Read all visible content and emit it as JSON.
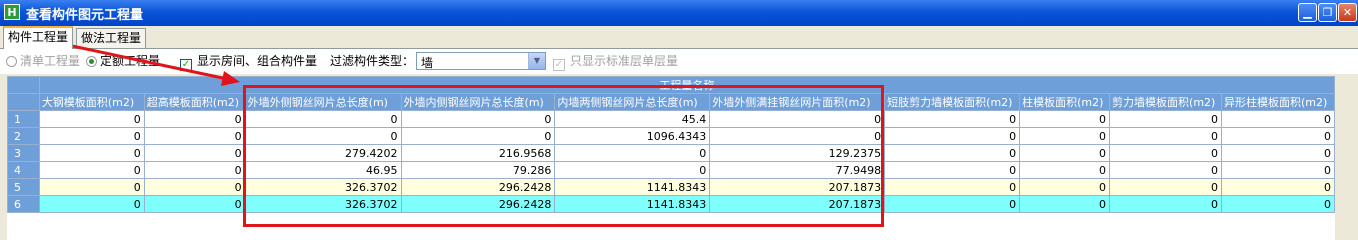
{
  "window": {
    "title": "查看构件图元工程量",
    "icon": "H",
    "minimize_icon": "minimize-icon",
    "restore_icon": "restore-icon",
    "close_icon": "close-icon"
  },
  "tabs": [
    {
      "label": "构件工程量",
      "active": true
    },
    {
      "label": "做法工程量",
      "active": false
    }
  ],
  "toolbar": {
    "radio_list_label": "清单工程量",
    "radio_quota_label": "定额工程量",
    "show_room_label": "显示房间、组合构件量",
    "filter_label": "过滤构件类型：",
    "filter_value": "墙",
    "standard_floor_label": "只显示标准层单层量"
  },
  "grid": {
    "group_header": "工程量名称",
    "columns": [
      "大钢模板面积(m2)",
      "超高模板面积(m2)",
      "外墙外侧钢丝网片总长度(m)",
      "外墙内侧钢丝网片总长度(m)",
      "内墙两侧钢丝网片总长度(m)",
      "外墙外侧满挂钢丝网片面积(m2)",
      "短肢剪力墙模板面积(m2)",
      "柱模板面积(m2)",
      "剪力墙模板面积(m2)",
      "异形柱模板面积(m2)"
    ],
    "rows": [
      {
        "num": "1",
        "cells": [
          "0",
          "0",
          "0",
          "0",
          "45.4",
          "0",
          "0",
          "0",
          "0",
          "0"
        ],
        "style": "white"
      },
      {
        "num": "2",
        "cells": [
          "0",
          "0",
          "0",
          "0",
          "1096.4343",
          "0",
          "0",
          "0",
          "0",
          "0"
        ],
        "style": "white"
      },
      {
        "num": "3",
        "cells": [
          "0",
          "0",
          "279.4202",
          "216.9568",
          "0",
          "129.2375",
          "0",
          "0",
          "0",
          "0"
        ],
        "style": "white"
      },
      {
        "num": "4",
        "cells": [
          "0",
          "0",
          "46.95",
          "79.286",
          "0",
          "77.9498",
          "0",
          "0",
          "0",
          "0"
        ],
        "style": "white"
      },
      {
        "num": "5",
        "cells": [
          "0",
          "0",
          "326.3702",
          "296.2428",
          "1141.8343",
          "207.1873",
          "0",
          "0",
          "0",
          "0"
        ],
        "style": "yellow"
      },
      {
        "num": "6",
        "cells": [
          "0",
          "0",
          "326.3702",
          "296.2428",
          "1141.8343",
          "207.1873",
          "0",
          "0",
          "0",
          "0"
        ],
        "style": "cyan"
      }
    ]
  },
  "colors": {
    "highlight": "#e0151c",
    "header": "#6f9fd8",
    "total_row": "#7ffffd",
    "subtotal_row": "#ffffe0"
  }
}
